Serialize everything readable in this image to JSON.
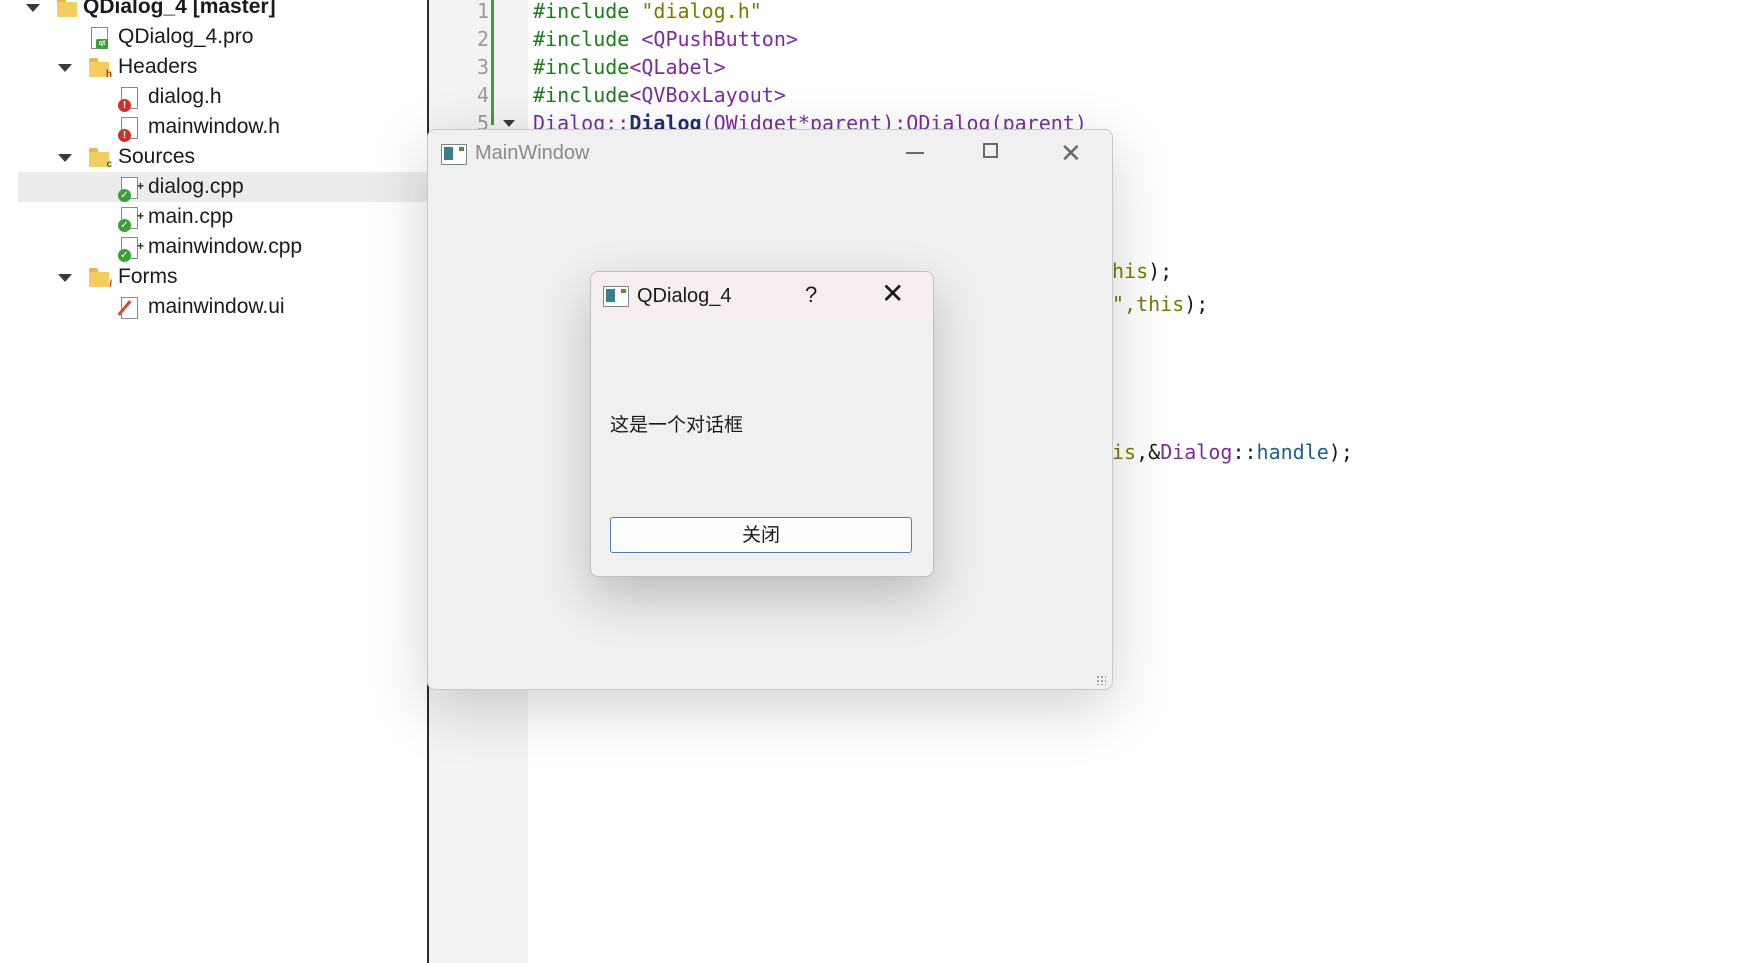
{
  "project_tree": {
    "root": "QDialog_4 [master]",
    "items": [
      {
        "label": "QDialog_4.pro",
        "icon": "qt-project-file-icon"
      },
      {
        "label": "Headers",
        "icon": "headers-folder-icon"
      },
      {
        "label": "dialog.h",
        "icon": "header-file-icon"
      },
      {
        "label": "mainwindow.h",
        "icon": "header-file-icon"
      },
      {
        "label": "Sources",
        "icon": "sources-folder-icon"
      },
      {
        "label": "dialog.cpp",
        "icon": "cpp-file-icon",
        "selected": true
      },
      {
        "label": "main.cpp",
        "icon": "cpp-file-icon"
      },
      {
        "label": "mainwindow.cpp",
        "icon": "cpp-file-icon"
      },
      {
        "label": "Forms",
        "icon": "forms-folder-icon"
      },
      {
        "label": "mainwindow.ui",
        "icon": "ui-file-icon"
      }
    ]
  },
  "editor": {
    "line_numbers": [
      "1",
      "2",
      "3",
      "4",
      "5"
    ],
    "lines": {
      "l1_dir": "#include",
      "l1_str": " \"dialog.h\"",
      "l2_dir": "#include",
      "l2_inc": " <QPushButton>",
      "l3_dir": "#include",
      "l3_inc": "<QLabel>",
      "l4_dir": "#include",
      "l4_inc": "<QVBoxLayout>",
      "l5_a": "Dialog::",
      "l5_b": "Dialog",
      "l5_c": "(QWidget*parent):QDialog(parent)",
      "frag1_a": "his",
      "frag1_b": ");",
      "frag2_a": "\",",
      "frag2_b": "this",
      "frag2_c": ");",
      "frag3_a": "is",
      "frag3_b": ",&",
      "frag3_c": "Dialog",
      "frag3_d": "::",
      "frag3_e": "handle",
      "frag3_f": ");"
    }
  },
  "main_window": {
    "title": "MainWindow"
  },
  "dialog": {
    "title": "QDialog_4",
    "help": "?",
    "close": "✕",
    "label": "这是一个对话框",
    "button": "关闭"
  },
  "colors": {
    "green_change_bar": "#3a9f3a",
    "dialog_button_border": "#4a7fbf"
  }
}
